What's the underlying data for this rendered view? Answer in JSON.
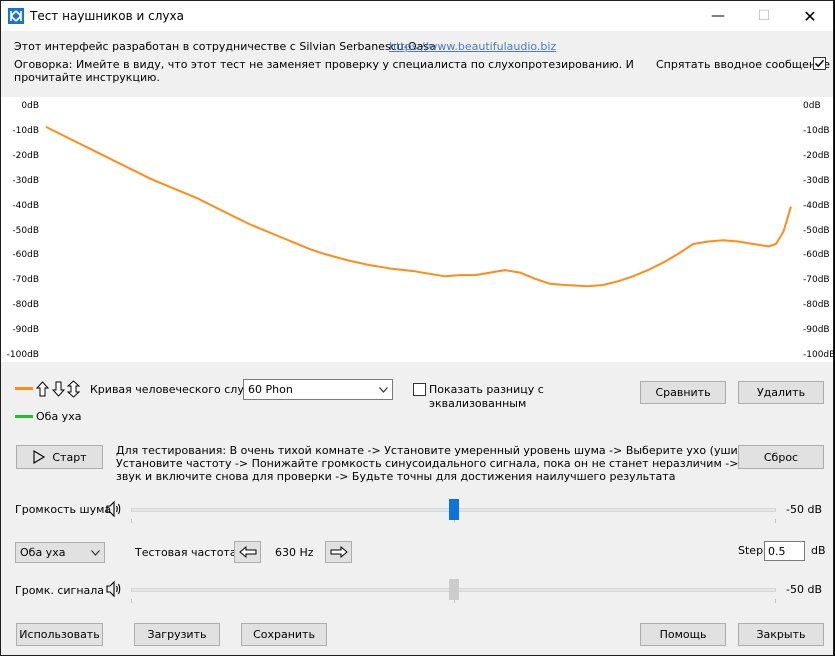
{
  "window": {
    "title": "Тест наушников и слуха",
    "minimize": "—",
    "maximize": "☐",
    "close": "✕"
  },
  "intro": {
    "line1": "Этот интерфейс разработан в сотрудничестве с Silvian Serbanescu-Oasa",
    "link": "https://www.beautifulaudio.biz",
    "disclaimer_line1": "Оговорка: Имейте в виду, что этот тест не заменяет проверку у специалиста по слухопротезированию. И",
    "disclaimer_line2": "прочитайте инструкцию.",
    "hide_label": "Спрятать вводное сообщение",
    "hide_checked": true
  },
  "chart_data": {
    "type": "line",
    "yticks": [
      "0dB",
      "-10dB",
      "-20dB",
      "-30dB",
      "-40dB",
      "-50dB",
      "-60dB",
      "-70dB",
      "-80dB",
      "-90dB",
      "-100dB"
    ],
    "ylim": [
      -100,
      0
    ],
    "line_color": "#ff8c1a",
    "grid": false,
    "series": [
      {
        "values": [
          [
            0,
            -8
          ],
          [
            2,
            -11
          ],
          [
            4,
            -14
          ],
          [
            6,
            -17
          ],
          [
            8,
            -20
          ],
          [
            10,
            -23
          ],
          [
            12,
            -26
          ],
          [
            14,
            -29
          ],
          [
            16,
            -31.5
          ],
          [
            18,
            -34
          ],
          [
            20,
            -36.5
          ],
          [
            21,
            -38
          ],
          [
            23,
            -41
          ],
          [
            25,
            -44
          ],
          [
            27,
            -47
          ],
          [
            29,
            -49.5
          ],
          [
            31,
            -52
          ],
          [
            33,
            -54.5
          ],
          [
            35,
            -57
          ],
          [
            37,
            -59
          ],
          [
            40,
            -61.5
          ],
          [
            43,
            -63.5
          ],
          [
            46,
            -65
          ],
          [
            49,
            -66
          ],
          [
            51,
            -67
          ],
          [
            53,
            -68
          ],
          [
            55,
            -67.5
          ],
          [
            57,
            -67.5
          ],
          [
            59,
            -66.5
          ],
          [
            61,
            -65.5
          ],
          [
            63,
            -66.5
          ],
          [
            65,
            -69
          ],
          [
            67,
            -71
          ],
          [
            69,
            -71.5
          ],
          [
            72,
            -72
          ],
          [
            74,
            -71.5
          ],
          [
            76,
            -70
          ],
          [
            78,
            -68
          ],
          [
            80,
            -65.5
          ],
          [
            82,
            -62.5
          ],
          [
            84,
            -59
          ],
          [
            86,
            -55
          ],
          [
            88,
            -54
          ],
          [
            90,
            -53.5
          ],
          [
            92,
            -54
          ],
          [
            94,
            -55
          ],
          [
            96,
            -56
          ],
          [
            97,
            -55
          ],
          [
            98,
            -50
          ],
          [
            99,
            -40
          ]
        ]
      }
    ]
  },
  "legend": {
    "curve_label": "Кривая человеческого слуха",
    "curve_color": "#ff8c1a",
    "ears_label": "Оба уха",
    "ears_color": "#22bb33",
    "phon_select": "60 Phon",
    "show_diff_label_line1": "Показать разницу с",
    "show_diff_label_line2": "эквализованным",
    "show_diff_checked": false,
    "compare": "Сравнить",
    "delete": "Удалить"
  },
  "controls": {
    "start": "Старт",
    "reset": "Сброс",
    "instructions_line1": "Для тестирования: В очень тихой комнате -> Установите умеренный уровень шума -> Выберите ухо (уши) -> Старт ->",
    "instructions_line2": "Установите частоту -> Понижайте громкость синусоидального сигнала, пока он не станет неразличим -> Выключите",
    "instructions_line3": "звук и включите снова для проверки -> Будьте точны для достижения наилучшего результата",
    "noise_label": "Громкость шума",
    "noise_value": "-50 dB",
    "noise_level": 0.5,
    "ear_select": "Оба уха",
    "freq_label": "Тестовая частота",
    "freq_value": "630 Hz",
    "step_label": "Step",
    "step_value": "0.5",
    "step_unit": "dB",
    "signal_label": "Громк. сигнала",
    "signal_value": "-50 dB",
    "signal_level": 0.5
  },
  "bottom": {
    "use": "Использовать",
    "load": "Загрузить",
    "save": "Сохранить",
    "help": "Помощь",
    "close": "Закрыть"
  }
}
